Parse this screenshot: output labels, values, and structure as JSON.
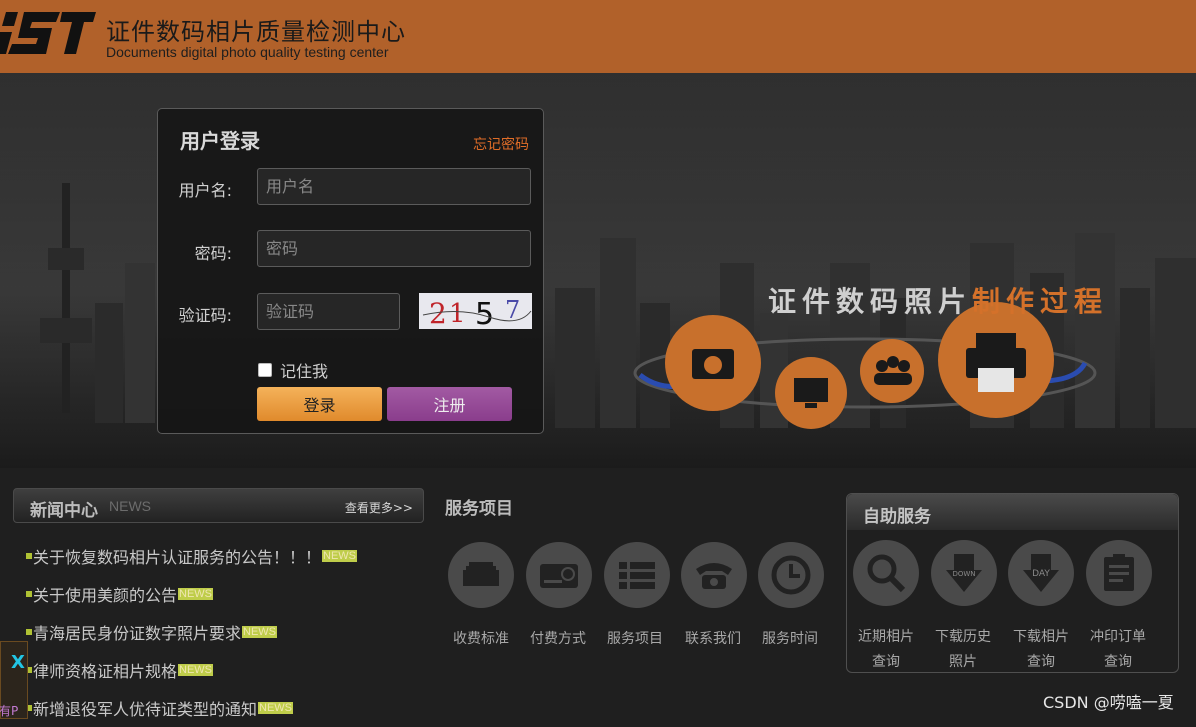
{
  "header": {
    "logo_text": "iST",
    "brand_cn": "证件数码相片质量检测中心",
    "brand_en": "Documents digital photo quality testing center"
  },
  "banner": {
    "process_title_a": "证件数码照片",
    "process_title_b": "制作过程"
  },
  "login": {
    "title": "用户登录",
    "forgot": "忘记密码",
    "username_label": "用户名:",
    "username_placeholder": "用户名",
    "password_label": "密码:",
    "password_placeholder": "密码",
    "captcha_label": "验证码:",
    "captcha_placeholder": "验证码",
    "captcha_text": "2157",
    "remember": "记住我",
    "login_btn": "登录",
    "register_btn": "注册"
  },
  "news": {
    "title": "新闻中心",
    "tag": "NEWS",
    "more": "查看更多>>",
    "items": [
      {
        "text": "关于恢复数码相片认证服务的公告！！！",
        "tag": "NEWS"
      },
      {
        "text": "关于使用美颜的公告",
        "tag": "NEWS"
      },
      {
        "text": "青海居民身份证数字照片要求",
        "tag": "NEWS"
      },
      {
        "text": "律师资格证相片规格",
        "tag": "NEWS"
      },
      {
        "text": "新增退役军人优待证类型的通知",
        "tag": "NEWS"
      }
    ]
  },
  "services": {
    "title": "服务项目",
    "items": [
      {
        "label": "收费标准",
        "icon": "money-icon"
      },
      {
        "label": "付费方式",
        "icon": "card-icon"
      },
      {
        "label": "服务项目",
        "icon": "list-icon"
      },
      {
        "label": "联系我们",
        "icon": "phone-icon"
      },
      {
        "label": "服务时间",
        "icon": "clock-icon"
      }
    ]
  },
  "self_service": {
    "title": "自助服务",
    "items": [
      {
        "line1": "近期相片",
        "line2": "查询",
        "icon": "search-icon"
      },
      {
        "line1": "下载历史",
        "line2": "照片",
        "icon": "download-icon"
      },
      {
        "line1": "下载相片",
        "line2": "查询",
        "icon": "day-download-icon"
      },
      {
        "line1": "冲印订单",
        "line2": "查询",
        "icon": "clipboard-icon"
      }
    ]
  },
  "footer": {
    "watermark": "CSDN @唠嗑一夏",
    "side_x": "X",
    "side_text": "有P"
  }
}
